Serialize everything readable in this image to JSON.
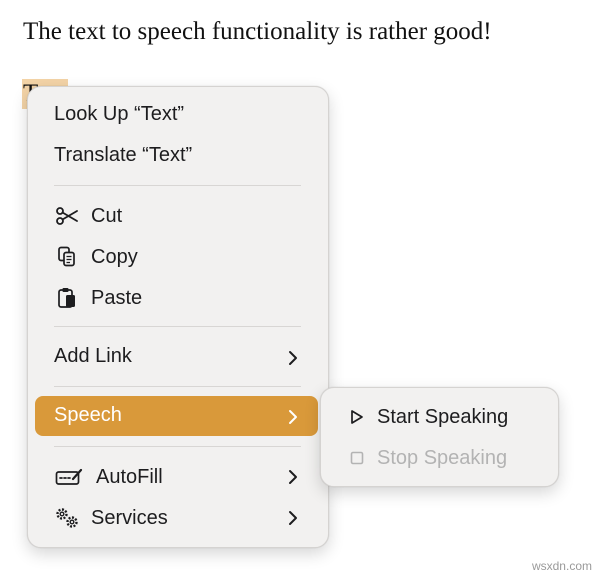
{
  "document": {
    "text": "The text to speech functionality is rather good!",
    "selected_word": "Text"
  },
  "context_menu": {
    "look_up": "Look Up “Text”",
    "translate": "Translate “Text”",
    "cut": "Cut",
    "copy": "Copy",
    "paste": "Paste",
    "add_link": "Add Link",
    "speech": "Speech",
    "autofill": "AutoFill",
    "services": "Services"
  },
  "speech_submenu": {
    "start_speaking": "Start Speaking",
    "stop_speaking": "Stop Speaking"
  },
  "colors": {
    "highlight": "#d9993a",
    "selection": "#f3d3a6",
    "menu_background": "#f2f1f0",
    "disabled_text": "#b3b3b3"
  },
  "watermark": "wsxdn.com"
}
